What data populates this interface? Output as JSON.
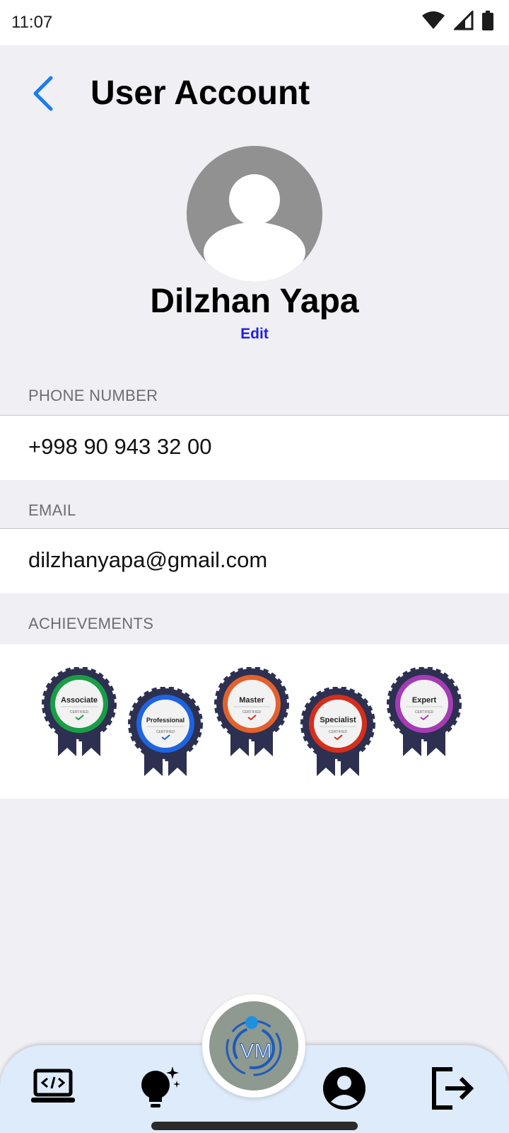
{
  "status_bar": {
    "time": "11:07"
  },
  "header": {
    "title": "User Account"
  },
  "profile": {
    "name": "Dilzhan Yapa",
    "edit_label": "Edit"
  },
  "fields": {
    "phone": {
      "label": "PHONE NUMBER",
      "value": "+998 90 943 32 00"
    },
    "email": {
      "label": "EMAIL",
      "value": "dilzhanyapa@gmail.com"
    }
  },
  "achievements": {
    "label": "ACHIEVEMENTS",
    "badges": [
      {
        "name": "Associate",
        "caption": "CERTIFIED",
        "color": "#1A9E45"
      },
      {
        "name": "Professional",
        "caption": "CERTIFIED",
        "color": "#1E63E0"
      },
      {
        "name": "Master",
        "caption": "CERTIFIED",
        "color": "#E2622E"
      },
      {
        "name": "Specialist",
        "caption": "CERTIFIED",
        "color": "#D42E1C"
      },
      {
        "name": "Expert",
        "caption": "CERTIFIED",
        "color": "#A53BB5"
      }
    ]
  },
  "logo": {
    "text": "VM"
  },
  "bottom_nav": {
    "items": [
      {
        "icon": "laptop-code-icon"
      },
      {
        "icon": "lightbulb-sparkle-icon"
      },
      {
        "icon": "vm-logo-icon"
      },
      {
        "icon": "account-circle-icon"
      },
      {
        "icon": "logout-icon"
      }
    ]
  },
  "colors": {
    "accent_blue": "#1A7CF0",
    "edit_link": "#2222DD",
    "nav_background": "#DDEBFA"
  }
}
